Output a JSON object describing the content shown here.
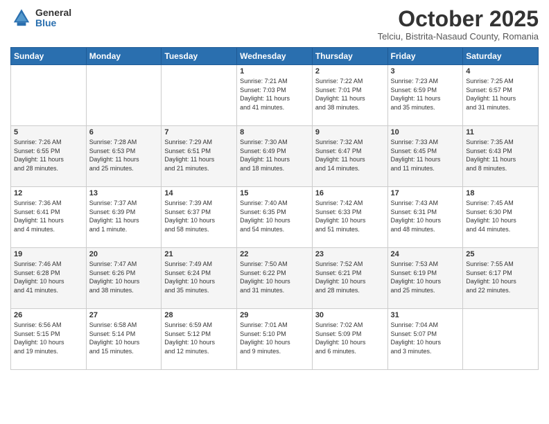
{
  "header": {
    "logo_general": "General",
    "logo_blue": "Blue",
    "month": "October 2025",
    "location": "Telciu, Bistrita-Nasaud County, Romania"
  },
  "weekdays": [
    "Sunday",
    "Monday",
    "Tuesday",
    "Wednesday",
    "Thursday",
    "Friday",
    "Saturday"
  ],
  "weeks": [
    [
      {
        "day": "",
        "info": ""
      },
      {
        "day": "",
        "info": ""
      },
      {
        "day": "",
        "info": ""
      },
      {
        "day": "1",
        "info": "Sunrise: 7:21 AM\nSunset: 7:03 PM\nDaylight: 11 hours\nand 41 minutes."
      },
      {
        "day": "2",
        "info": "Sunrise: 7:22 AM\nSunset: 7:01 PM\nDaylight: 11 hours\nand 38 minutes."
      },
      {
        "day": "3",
        "info": "Sunrise: 7:23 AM\nSunset: 6:59 PM\nDaylight: 11 hours\nand 35 minutes."
      },
      {
        "day": "4",
        "info": "Sunrise: 7:25 AM\nSunset: 6:57 PM\nDaylight: 11 hours\nand 31 minutes."
      }
    ],
    [
      {
        "day": "5",
        "info": "Sunrise: 7:26 AM\nSunset: 6:55 PM\nDaylight: 11 hours\nand 28 minutes."
      },
      {
        "day": "6",
        "info": "Sunrise: 7:28 AM\nSunset: 6:53 PM\nDaylight: 11 hours\nand 25 minutes."
      },
      {
        "day": "7",
        "info": "Sunrise: 7:29 AM\nSunset: 6:51 PM\nDaylight: 11 hours\nand 21 minutes."
      },
      {
        "day": "8",
        "info": "Sunrise: 7:30 AM\nSunset: 6:49 PM\nDaylight: 11 hours\nand 18 minutes."
      },
      {
        "day": "9",
        "info": "Sunrise: 7:32 AM\nSunset: 6:47 PM\nDaylight: 11 hours\nand 14 minutes."
      },
      {
        "day": "10",
        "info": "Sunrise: 7:33 AM\nSunset: 6:45 PM\nDaylight: 11 hours\nand 11 minutes."
      },
      {
        "day": "11",
        "info": "Sunrise: 7:35 AM\nSunset: 6:43 PM\nDaylight: 11 hours\nand 8 minutes."
      }
    ],
    [
      {
        "day": "12",
        "info": "Sunrise: 7:36 AM\nSunset: 6:41 PM\nDaylight: 11 hours\nand 4 minutes."
      },
      {
        "day": "13",
        "info": "Sunrise: 7:37 AM\nSunset: 6:39 PM\nDaylight: 11 hours\nand 1 minute."
      },
      {
        "day": "14",
        "info": "Sunrise: 7:39 AM\nSunset: 6:37 PM\nDaylight: 10 hours\nand 58 minutes."
      },
      {
        "day": "15",
        "info": "Sunrise: 7:40 AM\nSunset: 6:35 PM\nDaylight: 10 hours\nand 54 minutes."
      },
      {
        "day": "16",
        "info": "Sunrise: 7:42 AM\nSunset: 6:33 PM\nDaylight: 10 hours\nand 51 minutes."
      },
      {
        "day": "17",
        "info": "Sunrise: 7:43 AM\nSunset: 6:31 PM\nDaylight: 10 hours\nand 48 minutes."
      },
      {
        "day": "18",
        "info": "Sunrise: 7:45 AM\nSunset: 6:30 PM\nDaylight: 10 hours\nand 44 minutes."
      }
    ],
    [
      {
        "day": "19",
        "info": "Sunrise: 7:46 AM\nSunset: 6:28 PM\nDaylight: 10 hours\nand 41 minutes."
      },
      {
        "day": "20",
        "info": "Sunrise: 7:47 AM\nSunset: 6:26 PM\nDaylight: 10 hours\nand 38 minutes."
      },
      {
        "day": "21",
        "info": "Sunrise: 7:49 AM\nSunset: 6:24 PM\nDaylight: 10 hours\nand 35 minutes."
      },
      {
        "day": "22",
        "info": "Sunrise: 7:50 AM\nSunset: 6:22 PM\nDaylight: 10 hours\nand 31 minutes."
      },
      {
        "day": "23",
        "info": "Sunrise: 7:52 AM\nSunset: 6:21 PM\nDaylight: 10 hours\nand 28 minutes."
      },
      {
        "day": "24",
        "info": "Sunrise: 7:53 AM\nSunset: 6:19 PM\nDaylight: 10 hours\nand 25 minutes."
      },
      {
        "day": "25",
        "info": "Sunrise: 7:55 AM\nSunset: 6:17 PM\nDaylight: 10 hours\nand 22 minutes."
      }
    ],
    [
      {
        "day": "26",
        "info": "Sunrise: 6:56 AM\nSunset: 5:15 PM\nDaylight: 10 hours\nand 19 minutes."
      },
      {
        "day": "27",
        "info": "Sunrise: 6:58 AM\nSunset: 5:14 PM\nDaylight: 10 hours\nand 15 minutes."
      },
      {
        "day": "28",
        "info": "Sunrise: 6:59 AM\nSunset: 5:12 PM\nDaylight: 10 hours\nand 12 minutes."
      },
      {
        "day": "29",
        "info": "Sunrise: 7:01 AM\nSunset: 5:10 PM\nDaylight: 10 hours\nand 9 minutes."
      },
      {
        "day": "30",
        "info": "Sunrise: 7:02 AM\nSunset: 5:09 PM\nDaylight: 10 hours\nand 6 minutes."
      },
      {
        "day": "31",
        "info": "Sunrise: 7:04 AM\nSunset: 5:07 PM\nDaylight: 10 hours\nand 3 minutes."
      },
      {
        "day": "",
        "info": ""
      }
    ]
  ]
}
